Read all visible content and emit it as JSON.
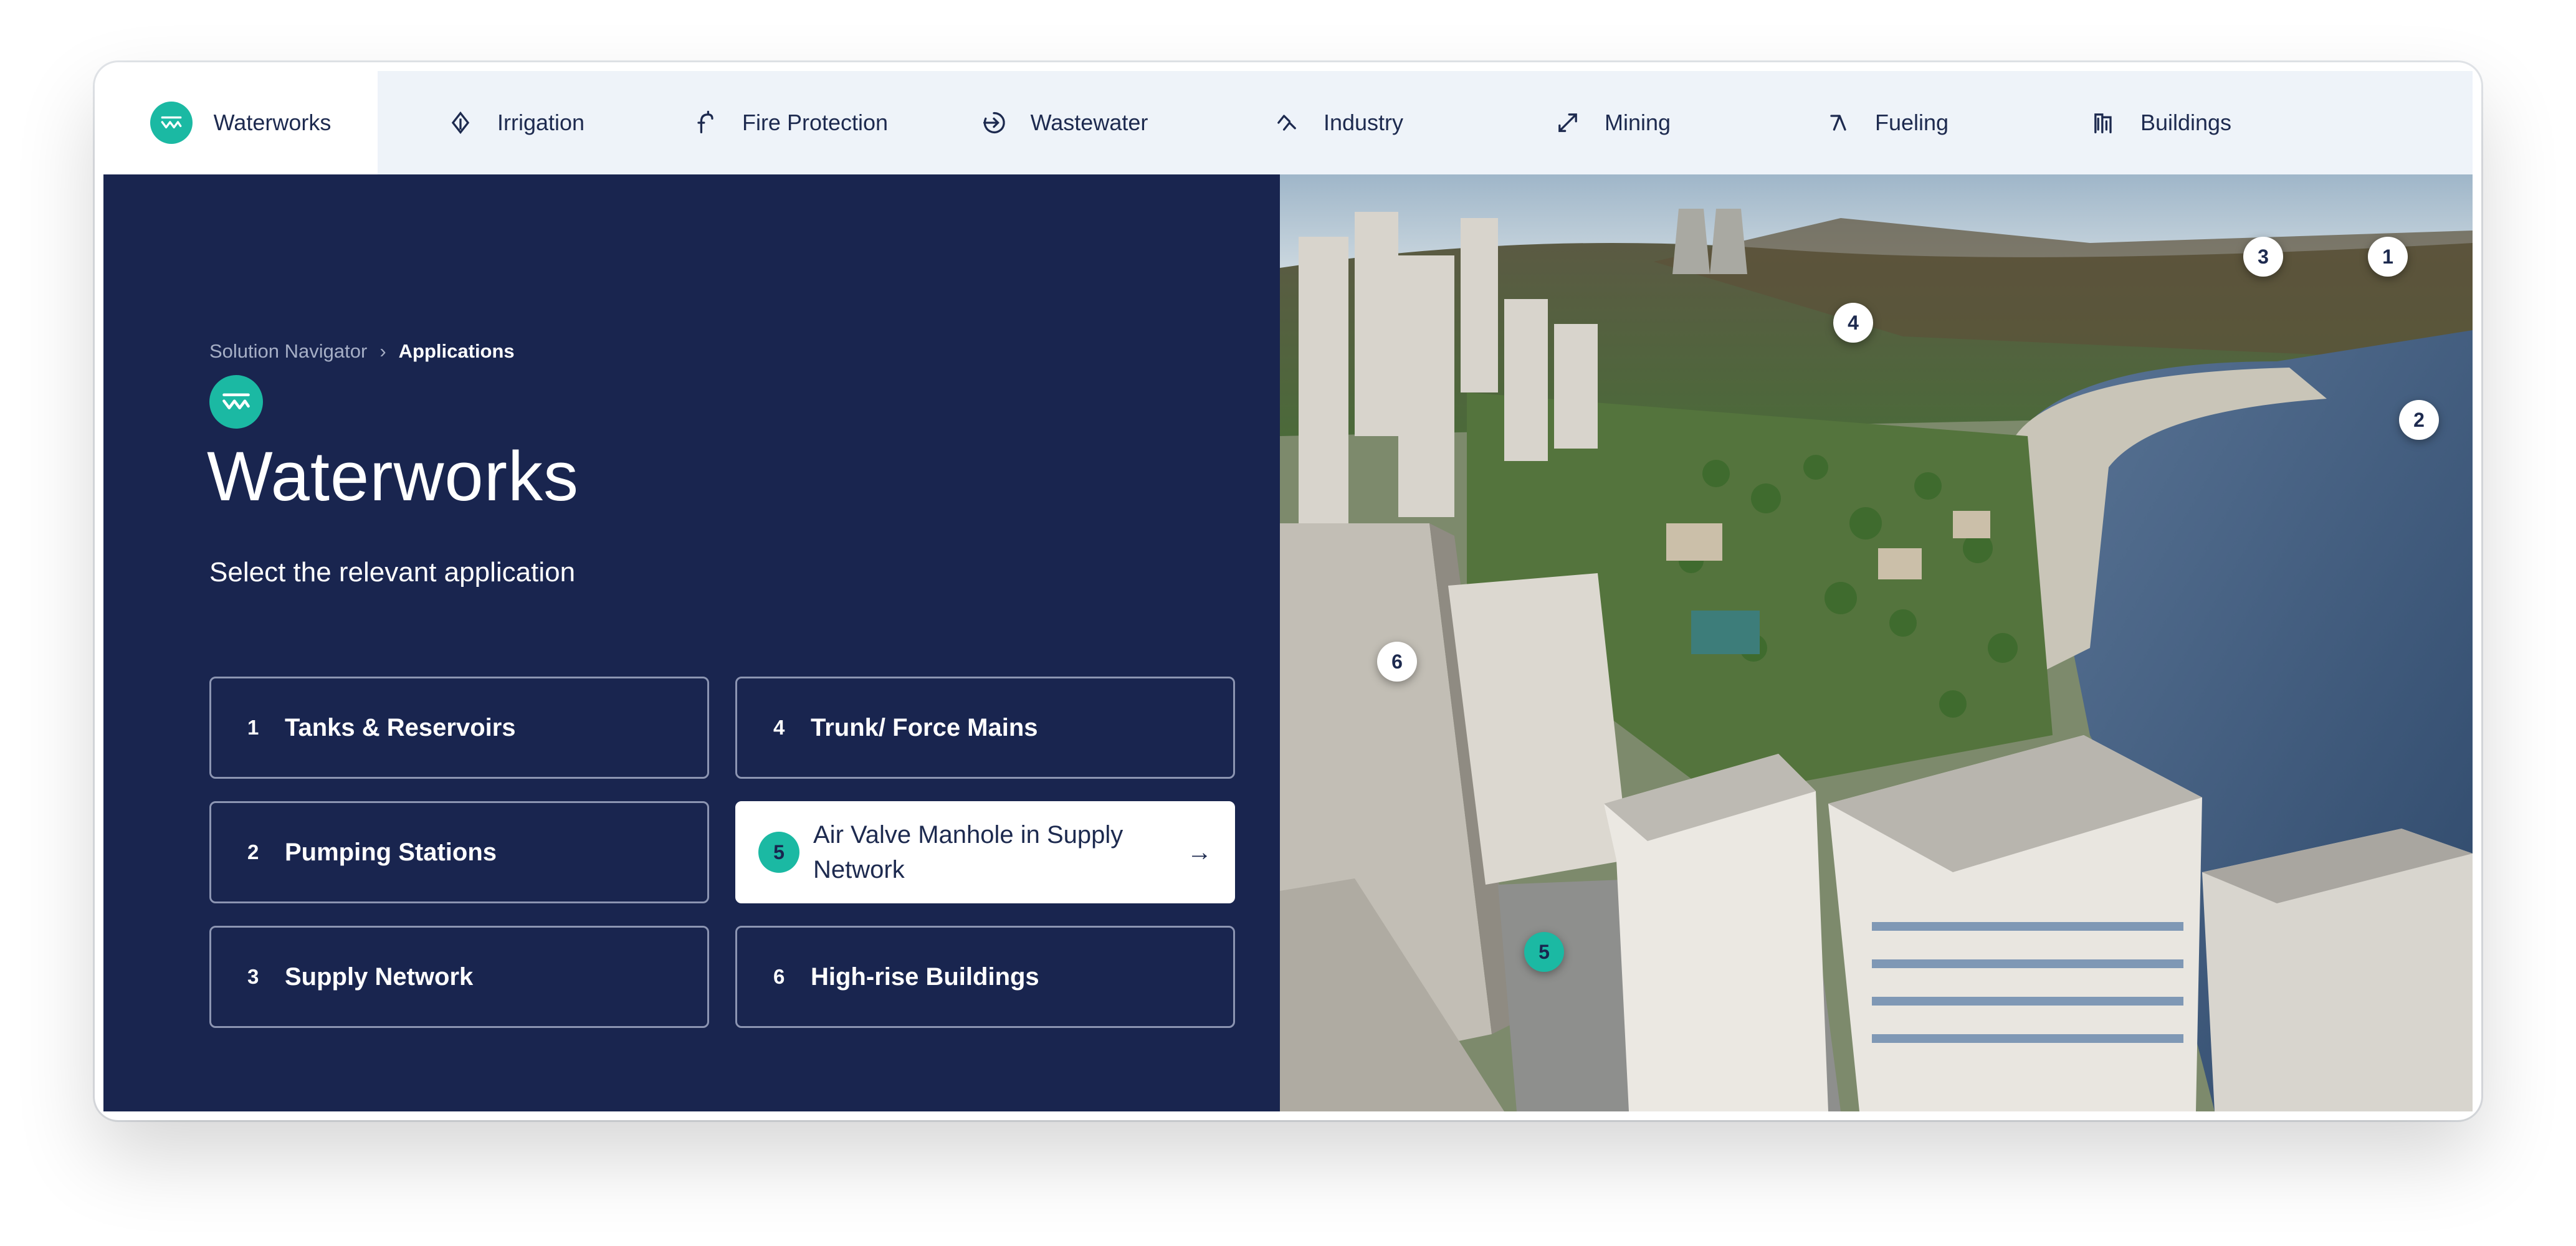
{
  "nav": {
    "tabs": [
      {
        "label": "Waterworks",
        "icon": "waterworks-icon",
        "active": true
      },
      {
        "label": "Irrigation",
        "icon": "irrigation-icon"
      },
      {
        "label": "Fire Protection",
        "icon": "fire-protection-icon"
      },
      {
        "label": "Wastewater",
        "icon": "wastewater-icon"
      },
      {
        "label": "Industry",
        "icon": "industry-icon"
      },
      {
        "label": "Mining",
        "icon": "mining-icon"
      },
      {
        "label": "Fueling",
        "icon": "fueling-icon"
      },
      {
        "label": "Buildings",
        "icon": "buildings-icon"
      }
    ]
  },
  "breadcrumb": {
    "root": "Solution Navigator",
    "separator": "›",
    "current": "Applications"
  },
  "page": {
    "title": "Waterworks",
    "subtitle": "Select the relevant application"
  },
  "applications": [
    {
      "num": "1",
      "label": "Tanks & Reservoirs"
    },
    {
      "num": "2",
      "label": "Pumping Stations"
    },
    {
      "num": "3",
      "label": "Supply Network"
    },
    {
      "num": "4",
      "label": "Trunk/ Force Mains"
    },
    {
      "num": "5",
      "label": "Air Valve Manhole in Supply Network",
      "active": true,
      "arrow": "→"
    },
    {
      "num": "6",
      "label": "High-rise Buildings"
    }
  ],
  "markers": [
    "1",
    "2",
    "3",
    "4",
    "5",
    "6"
  ],
  "colors": {
    "navy": "#19254f",
    "accent": "#1bb9a3",
    "nav_bg": "#eef3f9",
    "text_dark": "#1d2a4f"
  }
}
